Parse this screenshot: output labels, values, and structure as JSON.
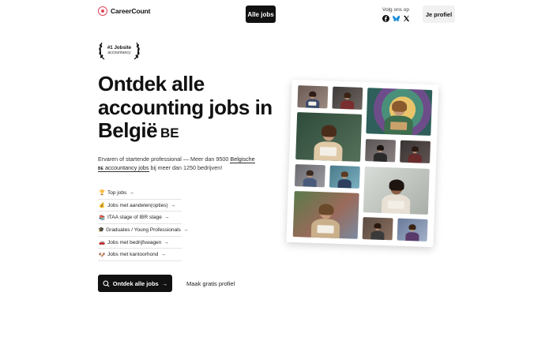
{
  "header": {
    "logo_text": "CareerCount",
    "nav_button": "Alle jobs",
    "follow_label": "Volg ons op",
    "social": [
      "facebook-icon",
      "bluesky-icon",
      "x-icon"
    ],
    "profile_button": "Je profiel"
  },
  "badge": {
    "title": "#1 Jobsite",
    "subtitle": "accountancy"
  },
  "hero": {
    "title": "Ontdek alle accounting jobs in België",
    "flag": "BE"
  },
  "intro": {
    "part1": "Ervaren of startende professional — Meer dan 9500 ",
    "link": "Belgische",
    "flag": "BE",
    "link2": "accountancy jobs",
    "part2": " bij meer dan 1250 bedrijven!"
  },
  "links": [
    {
      "emoji": "🏆",
      "label": "Top jobs"
    },
    {
      "emoji": "💰",
      "label": "Jobs met aandelen(opties)"
    },
    {
      "emoji": "📚",
      "label": "ITAA stage  of  IBR stage"
    },
    {
      "emoji": "🎓",
      "label": "Graduates / Young Professionals"
    },
    {
      "emoji": "🚗",
      "label": "Jobs met bedrijfswagen"
    },
    {
      "emoji": "🐶",
      "label": "Jobs met kantoorhond"
    }
  ],
  "cta": {
    "primary": "Ontdek alle jobs",
    "secondary": "Maak gratis profiel"
  },
  "colors": {
    "accent": "#e0445b",
    "dark": "#111111"
  }
}
